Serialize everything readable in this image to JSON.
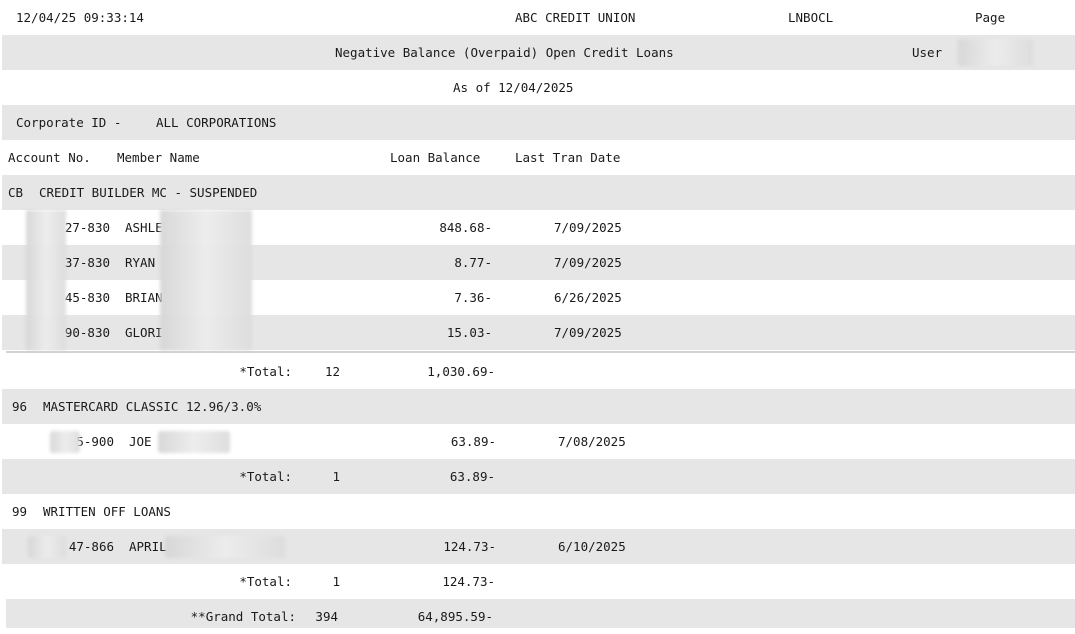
{
  "header": {
    "datetime": "12/04/25 09:33:14",
    "institution": "ABC CREDIT UNION",
    "report_code": "LNBOCL",
    "page_label": "Page",
    "report_title": "Negative Balance (Overpaid) Open Credit Loans",
    "user_label": "User",
    "as_of": "As of 12/04/2025"
  },
  "corporate": {
    "label": "Corporate ID -",
    "value": "ALL CORPORATIONS"
  },
  "columns": {
    "account_no": "Account No.",
    "member_name": "Member Name",
    "loan_balance": "Loan Balance",
    "last_tran_date": "Last Tran Date"
  },
  "sections": [
    {
      "code": "CB",
      "name": "CREDIT BUILDER MC - SUSPENDED",
      "rows": [
        {
          "account": "27-830",
          "name": "ASHLE",
          "balance": "848.68-",
          "date": "7/09/2025"
        },
        {
          "account": "37-830",
          "name": "RYAN",
          "balance": "8.77-",
          "date": "7/09/2025"
        },
        {
          "account": "45-830",
          "name": "BRIAN",
          "balance": "7.36-",
          "date": "6/26/2025"
        },
        {
          "account": "90-830",
          "name": "GLORI",
          "balance": "15.03-",
          "date": "7/09/2025"
        }
      ],
      "total_label": "*Total:",
      "total_count": "12",
      "total_balance": "1,030.69-"
    },
    {
      "code": "96",
      "name": "MASTERCARD CLASSIC 12.96/3.0%",
      "rows": [
        {
          "account": "5-900",
          "name": "JOE",
          "balance": "63.89-",
          "date": "7/08/2025"
        }
      ],
      "total_label": "*Total:",
      "total_count": "1",
      "total_balance": "63.89-"
    },
    {
      "code": "99",
      "name": "WRITTEN OFF LOANS",
      "rows": [
        {
          "account": "47-866",
          "name": "APRIL",
          "balance": "124.73-",
          "date": "6/10/2025"
        }
      ],
      "total_label": "*Total:",
      "total_count": "1",
      "total_balance": "124.73-"
    }
  ],
  "grand_total": {
    "label": "**Grand Total:",
    "count": "394",
    "balance": "64,895.59-"
  }
}
